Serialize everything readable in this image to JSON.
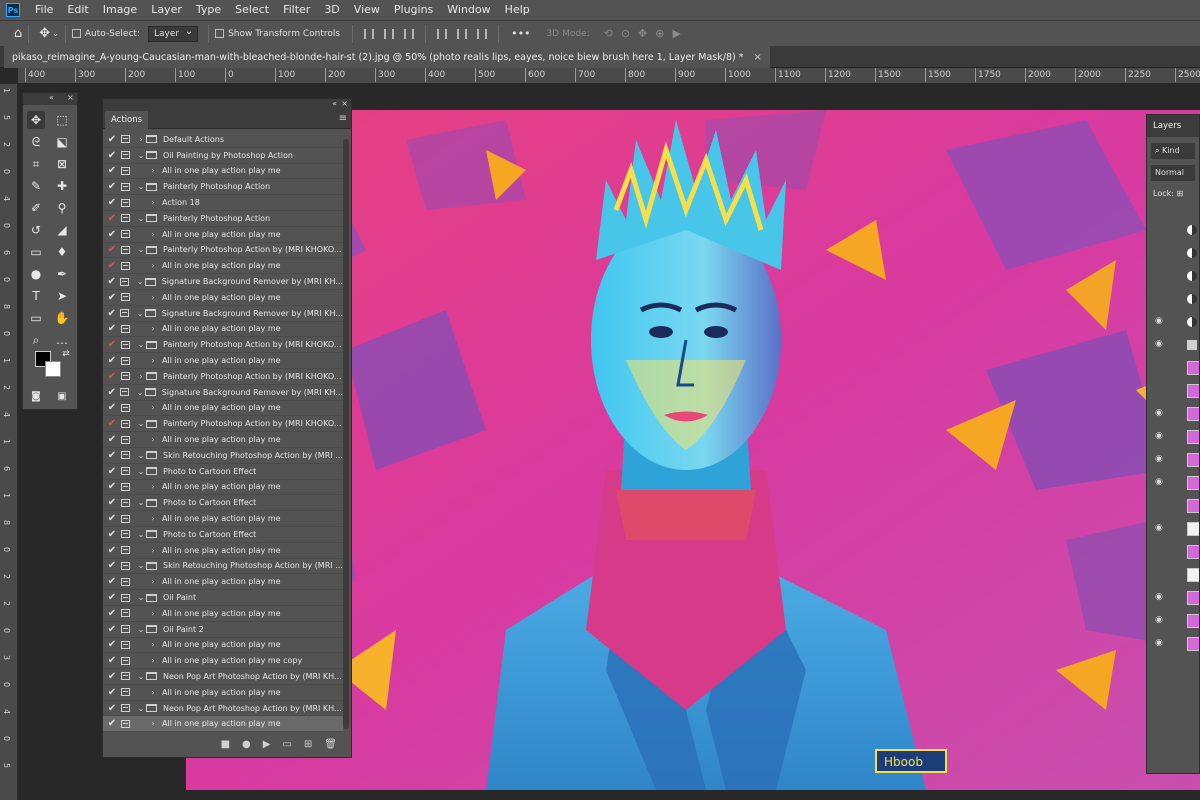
{
  "app": {
    "logo": "Ps"
  },
  "menu": [
    "File",
    "Edit",
    "Image",
    "Layer",
    "Type",
    "Select",
    "Filter",
    "3D",
    "View",
    "Plugins",
    "Window",
    "Help"
  ],
  "options": {
    "auto_select_label": "Auto-Select:",
    "auto_select_value": "Layer",
    "show_transform_label": "Show Transform Controls",
    "mode_3d_label": "3D Mode:",
    "more_label": "•••"
  },
  "document": {
    "tab_title": "pikaso_reimagine_A-young-Caucasian-man-with-bleached-blonde-hair-st (2).jpg @ 50% (photo realis lips, eayes, noice biew brush here 1, Layer Mask/8) *",
    "close": "×"
  },
  "ruler": {
    "h_ticks": [
      "400",
      "300",
      "200",
      "100",
      "0",
      "100",
      "200",
      "300",
      "400",
      "500",
      "600",
      "700",
      "800",
      "900",
      "1000",
      "1100",
      "1200",
      "1500",
      "1500",
      "1750",
      "2000",
      "2000",
      "2250",
      "2500"
    ],
    "v_ticks": [
      "1",
      "5",
      "2",
      "0",
      "4",
      "0",
      "6",
      "0",
      "8",
      "0",
      "1",
      "2",
      "4",
      "1",
      "6",
      "1",
      "8",
      "0",
      "2",
      "2",
      "0",
      "3",
      "0",
      "4",
      "0",
      "5"
    ]
  },
  "actions_panel": {
    "tab_label": "Actions",
    "collapse_label": "«",
    "close_label": "×",
    "rows": [
      {
        "check": "✔",
        "red": false,
        "level": 0,
        "twisty": "›",
        "folder": true,
        "label": "Default Actions"
      },
      {
        "check": "✔",
        "red": false,
        "level": 0,
        "twisty": "⌄",
        "folder": true,
        "label": "Oil Painting by Photoshop Action"
      },
      {
        "check": "✔",
        "red": false,
        "level": 1,
        "twisty": "›",
        "folder": false,
        "label": "All in one play action play me"
      },
      {
        "check": "✔",
        "red": false,
        "level": 0,
        "twisty": "⌄",
        "folder": true,
        "label": "Painterly  Photoshop Action"
      },
      {
        "check": "✔",
        "red": false,
        "level": 1,
        "twisty": "›",
        "folder": false,
        "label": "Action 18"
      },
      {
        "check": "✔",
        "red": true,
        "level": 0,
        "twisty": "⌄",
        "folder": true,
        "label": "Painterly  Photoshop Action"
      },
      {
        "check": "✔",
        "red": false,
        "level": 1,
        "twisty": "›",
        "folder": false,
        "label": "All in one play action play me"
      },
      {
        "check": "✔",
        "red": true,
        "level": 0,
        "twisty": "⌄",
        "folder": true,
        "label": "Painterly  Photoshop Action by (MRI KHOKO..."
      },
      {
        "check": "✔",
        "red": true,
        "level": 1,
        "twisty": "›",
        "folder": false,
        "label": "All in one play action play me"
      },
      {
        "check": "✔",
        "red": false,
        "level": 0,
        "twisty": "⌄",
        "folder": true,
        "label": "Signature Background Remover by (MRI KH..."
      },
      {
        "check": "✔",
        "red": false,
        "level": 1,
        "twisty": "›",
        "folder": false,
        "label": "All in one play action play me"
      },
      {
        "check": "✔",
        "red": false,
        "level": 0,
        "twisty": "⌄",
        "folder": true,
        "label": "Signature Background Remover by (MRI KH..."
      },
      {
        "check": "✔",
        "red": false,
        "level": 1,
        "twisty": "›",
        "folder": false,
        "label": "All in one play action play me"
      },
      {
        "check": "✔",
        "red": true,
        "level": 0,
        "twisty": "⌄",
        "folder": true,
        "label": "Painterly  Photoshop Action by (MRI KHOKO..."
      },
      {
        "check": "✔",
        "red": false,
        "level": 1,
        "twisty": "›",
        "folder": false,
        "label": "All in one play action play me"
      },
      {
        "check": "✔",
        "red": true,
        "level": 0,
        "twisty": "›",
        "folder": true,
        "label": "Painterly  Photoshop Action by (MRI KHOKO..."
      },
      {
        "check": "✔",
        "red": false,
        "level": 0,
        "twisty": "⌄",
        "folder": true,
        "label": "Signature Background Remover by (MRI KH..."
      },
      {
        "check": "✔",
        "red": false,
        "level": 1,
        "twisty": "›",
        "folder": false,
        "label": "All in one play action play me"
      },
      {
        "check": "✔",
        "red": true,
        "level": 0,
        "twisty": "⌄",
        "folder": true,
        "label": "Painterly  Photoshop Action by (MRI KHOKO..."
      },
      {
        "check": "✔",
        "red": false,
        "level": 1,
        "twisty": "›",
        "folder": false,
        "label": "All in one play action play me"
      },
      {
        "check": "✔",
        "red": false,
        "level": 0,
        "twisty": "⌄",
        "folder": true,
        "label": "Skin Retouching Photoshop Action by (MRI ..."
      },
      {
        "check": "✔",
        "red": false,
        "level": 0,
        "twisty": "⌄",
        "folder": true,
        "label": "Photo to Cartoon Effect"
      },
      {
        "check": "✔",
        "red": false,
        "level": 1,
        "twisty": "›",
        "folder": false,
        "label": "All in one play action play me"
      },
      {
        "check": "✔",
        "red": false,
        "level": 0,
        "twisty": "⌄",
        "folder": true,
        "label": "Photo to Cartoon Effect"
      },
      {
        "check": "✔",
        "red": false,
        "level": 1,
        "twisty": "›",
        "folder": false,
        "label": "All in one play action play me"
      },
      {
        "check": "✔",
        "red": false,
        "level": 0,
        "twisty": "⌄",
        "folder": true,
        "label": "Photo to Cartoon Effect"
      },
      {
        "check": "✔",
        "red": false,
        "level": 1,
        "twisty": "›",
        "folder": false,
        "label": "All in one play action play me"
      },
      {
        "check": "✔",
        "red": false,
        "level": 0,
        "twisty": "⌄",
        "folder": true,
        "label": "Skin Retouching Photoshop Action by (MRI ..."
      },
      {
        "check": "✔",
        "red": false,
        "level": 1,
        "twisty": "›",
        "folder": false,
        "label": "All in one play action play me"
      },
      {
        "check": "✔",
        "red": false,
        "level": 0,
        "twisty": "⌄",
        "folder": true,
        "label": "Oil Paint"
      },
      {
        "check": "✔",
        "red": false,
        "level": 1,
        "twisty": "›",
        "folder": false,
        "label": "All in one play action play me"
      },
      {
        "check": "✔",
        "red": false,
        "level": 0,
        "twisty": "⌄",
        "folder": true,
        "label": "Oil Paint 2"
      },
      {
        "check": "✔",
        "red": false,
        "level": 1,
        "twisty": "›",
        "folder": false,
        "label": "All in one play action play me"
      },
      {
        "check": "✔",
        "red": false,
        "level": 1,
        "twisty": "›",
        "folder": false,
        "label": "All in one play action play me  copy"
      },
      {
        "check": "✔",
        "red": false,
        "level": 0,
        "twisty": "⌄",
        "folder": true,
        "label": "Neon Pop Art Photoshop Action by (MRI KH..."
      },
      {
        "check": "✔",
        "red": false,
        "level": 1,
        "twisty": "›",
        "folder": false,
        "label": "All in one play action play me"
      },
      {
        "check": "✔",
        "red": false,
        "level": 0,
        "twisty": "⌄",
        "folder": true,
        "label": "Neon Pop Art Photoshop Action by (MRI KH..."
      },
      {
        "check": "✔",
        "red": false,
        "level": 1,
        "twisty": "›",
        "folder": false,
        "label": "All in one play action play me",
        "selected": true
      }
    ],
    "bottom_icons": [
      "stop-icon",
      "record-icon",
      "play-icon",
      "folder-icon",
      "new-action-icon",
      "trash-icon"
    ]
  },
  "layers_panel": {
    "tab_label": "Layers",
    "kind_label": "Kind",
    "blend_mode": "Normal",
    "lock_label": "Lock:"
  },
  "artwork": {
    "badge_text": "Hboob"
  },
  "colors": {
    "accent": "#31a8ff",
    "bg": "#535353",
    "dark": "#282828",
    "check_red": "#e85050"
  }
}
